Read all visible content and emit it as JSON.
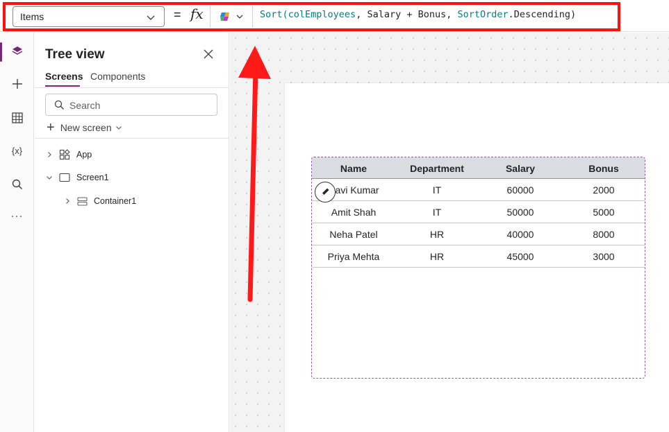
{
  "formula_bar": {
    "property": "Items",
    "equals": "=",
    "fx": "fx",
    "formula_parts": {
      "fn": "Sort(",
      "col": "colEmployees",
      "mid": ", Salary + Bonus, ",
      "enum": "SortOrder",
      "tail": ".Descending)"
    }
  },
  "rail": {
    "items": [
      "tree-view",
      "insert",
      "data",
      "variables",
      "search",
      "more"
    ],
    "variables_label": "{x}",
    "more_label": "···"
  },
  "tree": {
    "title": "Tree view",
    "tabs": [
      "Screens",
      "Components"
    ],
    "search_placeholder": "Search",
    "new_screen": "New screen",
    "nodes": [
      "App",
      "Screen1",
      "Container1"
    ]
  },
  "table": {
    "headers": [
      "Name",
      "Department",
      "Salary",
      "Bonus"
    ],
    "rows": [
      [
        "Ravi Kumar",
        "IT",
        "60000",
        "2000"
      ],
      [
        "Amit Shah",
        "IT",
        "50000",
        "5000"
      ],
      [
        "Neha Patel",
        "HR",
        "40000",
        "8000"
      ],
      [
        "Priya Mehta",
        "HR",
        "45000",
        "3000"
      ]
    ]
  },
  "colors": {
    "highlight": "#ff1010",
    "accent": "#742774"
  }
}
